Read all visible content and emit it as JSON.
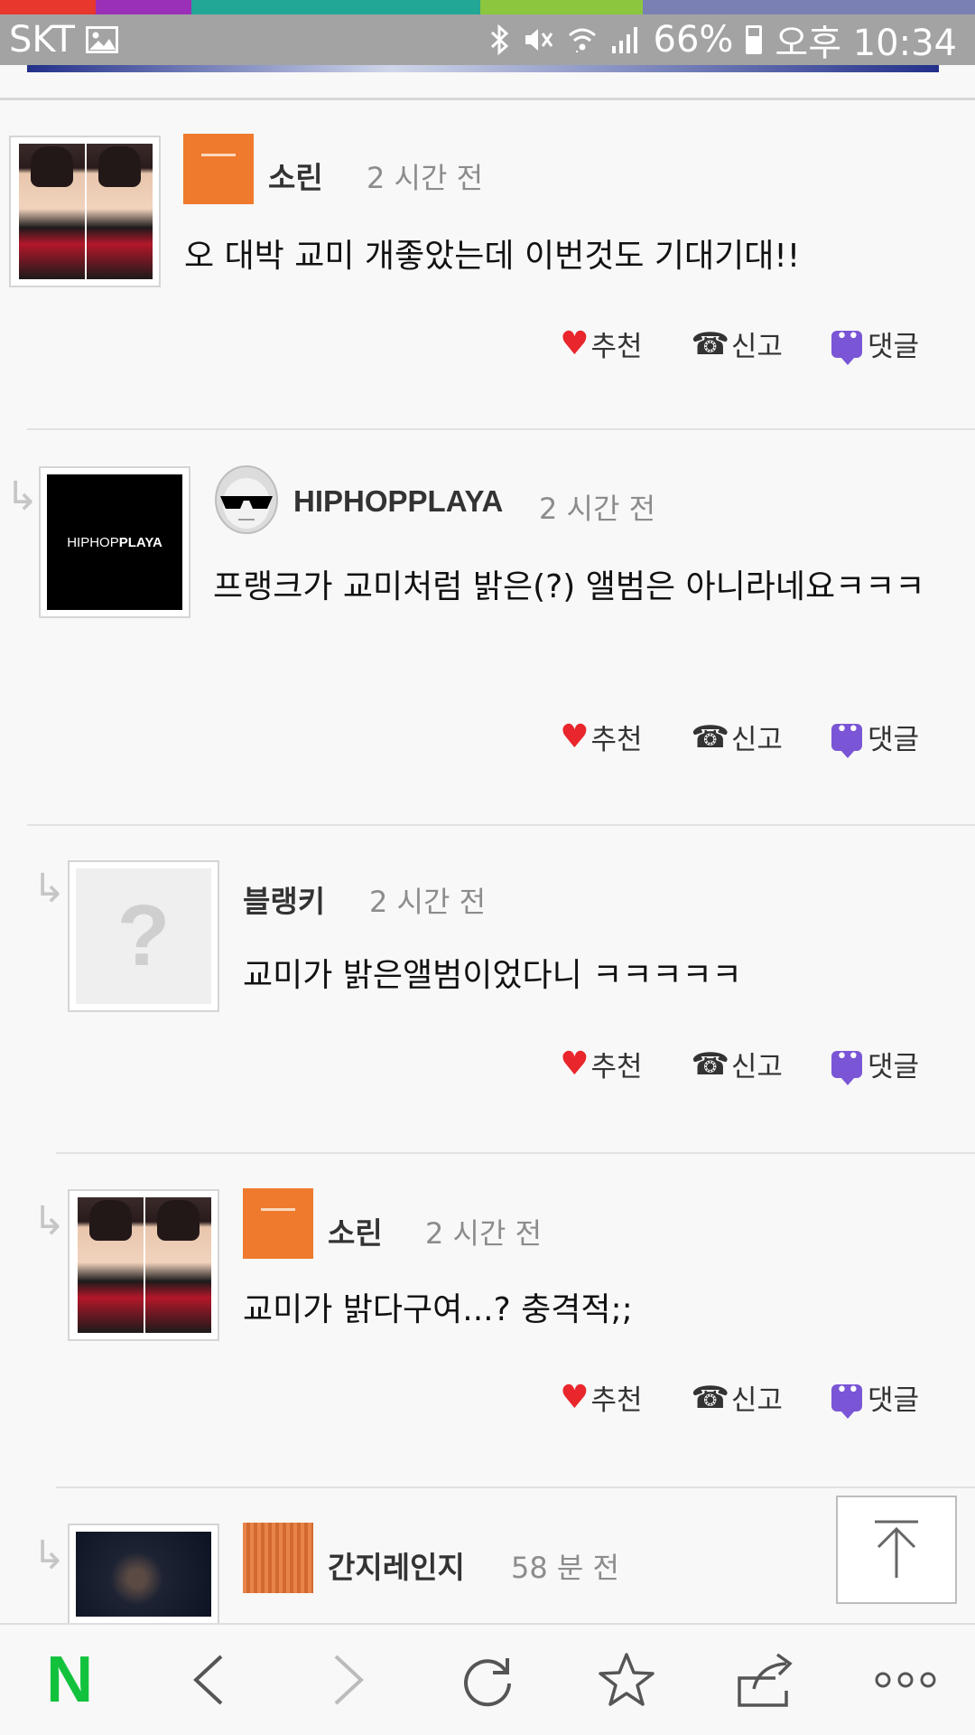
{
  "status_bar": {
    "carrier": "SKT",
    "battery": "66%",
    "time": "오후 10:34",
    "strip_colors": [
      "#e8372d",
      "#9b30b8",
      "#22a696",
      "#22a696",
      "#8cc63e",
      "#7a7fb4"
    ]
  },
  "actions": {
    "recommend": "추천",
    "report": "신고",
    "reply": "댓글"
  },
  "comments": [
    {
      "user": "소린",
      "time": "2 시간 전",
      "text": "오 대박 교미 개좋았는데 이번것도 기대기대!!",
      "avatar": "photo",
      "badge": "orange-level-icon"
    },
    {
      "user": "HIPHOPPLAYA",
      "time": "2 시간 전",
      "text": "프랭크가 교미처럼 밝은(?) 앨범은 아니라네요ㅋㅋㅋ",
      "avatar": "logo",
      "avatar_text_a": "HIPHOP",
      "avatar_text_b": "PLAYA",
      "badge": "mask-icon"
    },
    {
      "user": "블랭키",
      "time": "2 시간 전",
      "text": "교미가 밝은앨범이었다니 ㅋㅋㅋㅋㅋ",
      "avatar": "unknown",
      "avatar_text": "?"
    },
    {
      "user": "소린",
      "time": "2 시간 전",
      "text": "교미가 밝다구여...? 충격적;;",
      "avatar": "photo",
      "badge": "orange-level-icon"
    },
    {
      "user": "간지레인지",
      "time": "58 분 전",
      "text": "",
      "avatar": "dark-photo",
      "badge": "pattern-level-icon"
    }
  ],
  "colors": {
    "accent_orange": "#ef7a2d",
    "heart_red": "#e8262b",
    "reply_purple": "#7a55d6",
    "naver_green": "#12c23c"
  },
  "bottom_nav": {
    "logo": "N",
    "icons": [
      "naver-n-icon",
      "back-icon",
      "forward-icon",
      "refresh-icon",
      "bookmark-star-icon",
      "share-icon",
      "more-icon"
    ]
  }
}
